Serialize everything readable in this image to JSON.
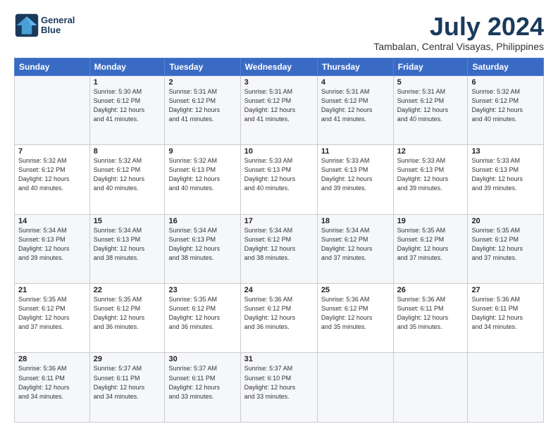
{
  "logo": {
    "line1": "General",
    "line2": "Blue"
  },
  "title": "July 2024",
  "subtitle": "Tambalan, Central Visayas, Philippines",
  "days_of_week": [
    "Sunday",
    "Monday",
    "Tuesday",
    "Wednesday",
    "Thursday",
    "Friday",
    "Saturday"
  ],
  "weeks": [
    [
      {
        "day": "",
        "info": ""
      },
      {
        "day": "1",
        "info": "Sunrise: 5:30 AM\nSunset: 6:12 PM\nDaylight: 12 hours\nand 41 minutes."
      },
      {
        "day": "2",
        "info": "Sunrise: 5:31 AM\nSunset: 6:12 PM\nDaylight: 12 hours\nand 41 minutes."
      },
      {
        "day": "3",
        "info": "Sunrise: 5:31 AM\nSunset: 6:12 PM\nDaylight: 12 hours\nand 41 minutes."
      },
      {
        "day": "4",
        "info": "Sunrise: 5:31 AM\nSunset: 6:12 PM\nDaylight: 12 hours\nand 41 minutes."
      },
      {
        "day": "5",
        "info": "Sunrise: 5:31 AM\nSunset: 6:12 PM\nDaylight: 12 hours\nand 40 minutes."
      },
      {
        "day": "6",
        "info": "Sunrise: 5:32 AM\nSunset: 6:12 PM\nDaylight: 12 hours\nand 40 minutes."
      }
    ],
    [
      {
        "day": "7",
        "info": "Sunrise: 5:32 AM\nSunset: 6:12 PM\nDaylight: 12 hours\nand 40 minutes."
      },
      {
        "day": "8",
        "info": "Sunrise: 5:32 AM\nSunset: 6:12 PM\nDaylight: 12 hours\nand 40 minutes."
      },
      {
        "day": "9",
        "info": "Sunrise: 5:32 AM\nSunset: 6:13 PM\nDaylight: 12 hours\nand 40 minutes."
      },
      {
        "day": "10",
        "info": "Sunrise: 5:33 AM\nSunset: 6:13 PM\nDaylight: 12 hours\nand 40 minutes."
      },
      {
        "day": "11",
        "info": "Sunrise: 5:33 AM\nSunset: 6:13 PM\nDaylight: 12 hours\nand 39 minutes."
      },
      {
        "day": "12",
        "info": "Sunrise: 5:33 AM\nSunset: 6:13 PM\nDaylight: 12 hours\nand 39 minutes."
      },
      {
        "day": "13",
        "info": "Sunrise: 5:33 AM\nSunset: 6:13 PM\nDaylight: 12 hours\nand 39 minutes."
      }
    ],
    [
      {
        "day": "14",
        "info": "Sunrise: 5:34 AM\nSunset: 6:13 PM\nDaylight: 12 hours\nand 39 minutes."
      },
      {
        "day": "15",
        "info": "Sunrise: 5:34 AM\nSunset: 6:13 PM\nDaylight: 12 hours\nand 38 minutes."
      },
      {
        "day": "16",
        "info": "Sunrise: 5:34 AM\nSunset: 6:13 PM\nDaylight: 12 hours\nand 38 minutes."
      },
      {
        "day": "17",
        "info": "Sunrise: 5:34 AM\nSunset: 6:12 PM\nDaylight: 12 hours\nand 38 minutes."
      },
      {
        "day": "18",
        "info": "Sunrise: 5:34 AM\nSunset: 6:12 PM\nDaylight: 12 hours\nand 37 minutes."
      },
      {
        "day": "19",
        "info": "Sunrise: 5:35 AM\nSunset: 6:12 PM\nDaylight: 12 hours\nand 37 minutes."
      },
      {
        "day": "20",
        "info": "Sunrise: 5:35 AM\nSunset: 6:12 PM\nDaylight: 12 hours\nand 37 minutes."
      }
    ],
    [
      {
        "day": "21",
        "info": "Sunrise: 5:35 AM\nSunset: 6:12 PM\nDaylight: 12 hours\nand 37 minutes."
      },
      {
        "day": "22",
        "info": "Sunrise: 5:35 AM\nSunset: 6:12 PM\nDaylight: 12 hours\nand 36 minutes."
      },
      {
        "day": "23",
        "info": "Sunrise: 5:35 AM\nSunset: 6:12 PM\nDaylight: 12 hours\nand 36 minutes."
      },
      {
        "day": "24",
        "info": "Sunrise: 5:36 AM\nSunset: 6:12 PM\nDaylight: 12 hours\nand 36 minutes."
      },
      {
        "day": "25",
        "info": "Sunrise: 5:36 AM\nSunset: 6:12 PM\nDaylight: 12 hours\nand 35 minutes."
      },
      {
        "day": "26",
        "info": "Sunrise: 5:36 AM\nSunset: 6:11 PM\nDaylight: 12 hours\nand 35 minutes."
      },
      {
        "day": "27",
        "info": "Sunrise: 5:36 AM\nSunset: 6:11 PM\nDaylight: 12 hours\nand 34 minutes."
      }
    ],
    [
      {
        "day": "28",
        "info": "Sunrise: 5:36 AM\nSunset: 6:11 PM\nDaylight: 12 hours\nand 34 minutes."
      },
      {
        "day": "29",
        "info": "Sunrise: 5:37 AM\nSunset: 6:11 PM\nDaylight: 12 hours\nand 34 minutes."
      },
      {
        "day": "30",
        "info": "Sunrise: 5:37 AM\nSunset: 6:11 PM\nDaylight: 12 hours\nand 33 minutes."
      },
      {
        "day": "31",
        "info": "Sunrise: 5:37 AM\nSunset: 6:10 PM\nDaylight: 12 hours\nand 33 minutes."
      },
      {
        "day": "",
        "info": ""
      },
      {
        "day": "",
        "info": ""
      },
      {
        "day": "",
        "info": ""
      }
    ]
  ]
}
